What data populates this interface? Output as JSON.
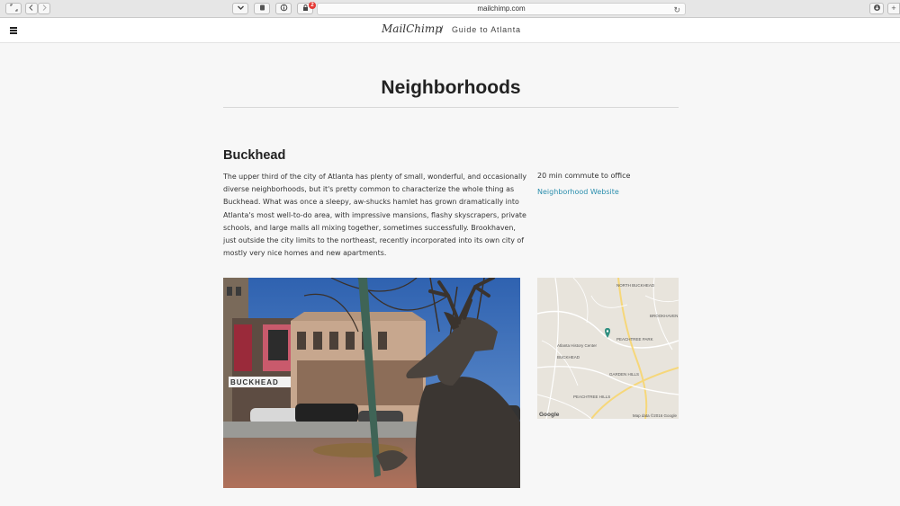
{
  "browser": {
    "url": "mailchimp.com",
    "notification_count": "2",
    "icons": [
      "sidebar-icon",
      "back-icon",
      "forward-icon",
      "pocket-icon",
      "evernote-icon",
      "info-icon",
      "password-icon",
      "reload-icon",
      "download-icon",
      "new-tab-icon"
    ]
  },
  "header": {
    "logo_text": "MailChimp",
    "separator": "/",
    "subtitle": "Guide to Atlanta"
  },
  "main": {
    "title": "Neighborhoods"
  },
  "neighborhood": {
    "name": "Buckhead",
    "description": "The upper third of the city of Atlanta has plenty of small, wonderful, and occasionally diverse neighborhoods, but it's pretty common to characterize the whole thing as Buckhead. What was once a sleepy, aw-shucks hamlet has grown dramatically into Atlanta's most well-to-do area, with impressive mansions, flashy skyscrapers, private schools, and large malls all mixing together, sometimes successfully. Brookhaven, just outside the city limits to the northeast, recently incorporated into its own city of mostly very nice homes and new apartments.",
    "commute": "20 min commute to office",
    "website_label": "Neighborhood Website",
    "photo_sign": "BUCKHEAD",
    "map": {
      "google_label": "Google",
      "attribution": "Map data ©2016 Google",
      "labels": {
        "history_center": "Atlanta History Center",
        "buckhead": "BUCKHEAD",
        "peachtree_park": "PEACHTREE PARK",
        "peachtree_hills": "PEACHTREE HILLS",
        "garden_hills": "GARDEN HILLS",
        "north_buckhead": "NORTH BUCKHEAD",
        "brookhaven": "BROOKHAVEN"
      }
    }
  },
  "colors": {
    "link": "#2c8fae",
    "background": "#f7f7f7",
    "badge": "#e53935"
  }
}
